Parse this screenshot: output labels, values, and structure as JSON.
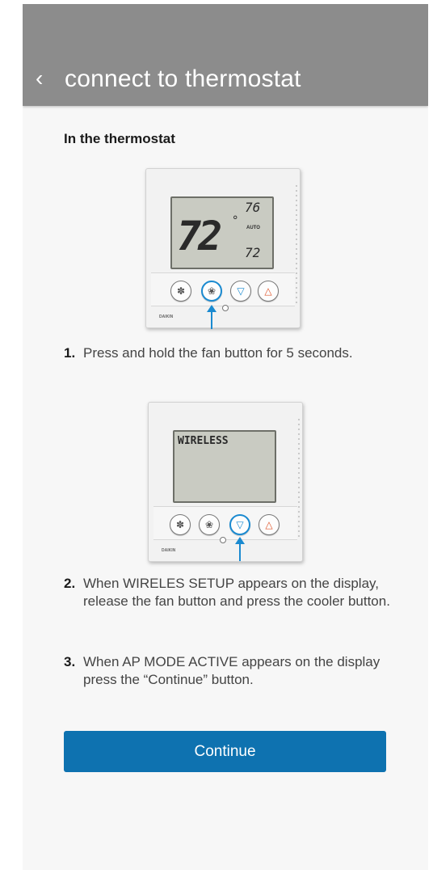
{
  "header": {
    "back_icon": "chevron-left-icon",
    "back_glyph": "‹",
    "title": "connect to thermostat"
  },
  "section": {
    "heading": "In the thermostat"
  },
  "thermostat_1": {
    "main_temp": "72",
    "degree": "°",
    "set_high": "76",
    "mode": "AUTO",
    "set_low": "72",
    "brand": "DAIKIN",
    "highlighted_button": "fan"
  },
  "thermostat_2": {
    "display_text": "WIRELESS",
    "brand": "DAIKIN",
    "highlighted_button": "cooler"
  },
  "steps": [
    {
      "num": "1.",
      "text": "Press and hold the fan button for 5 seconds."
    },
    {
      "num": "2.",
      "text": "When WIRELES SETUP appears on the display, release the fan button and press the cooler button."
    },
    {
      "num": "3.",
      "text": "When AP MODE ACTIVE appears on the display press the “Continue”  button."
    }
  ],
  "continue_button": {
    "label": "Continue"
  },
  "colors": {
    "header": "#8c8c8c",
    "accent": "#0e72b0",
    "highlight": "#1a8ad0"
  }
}
